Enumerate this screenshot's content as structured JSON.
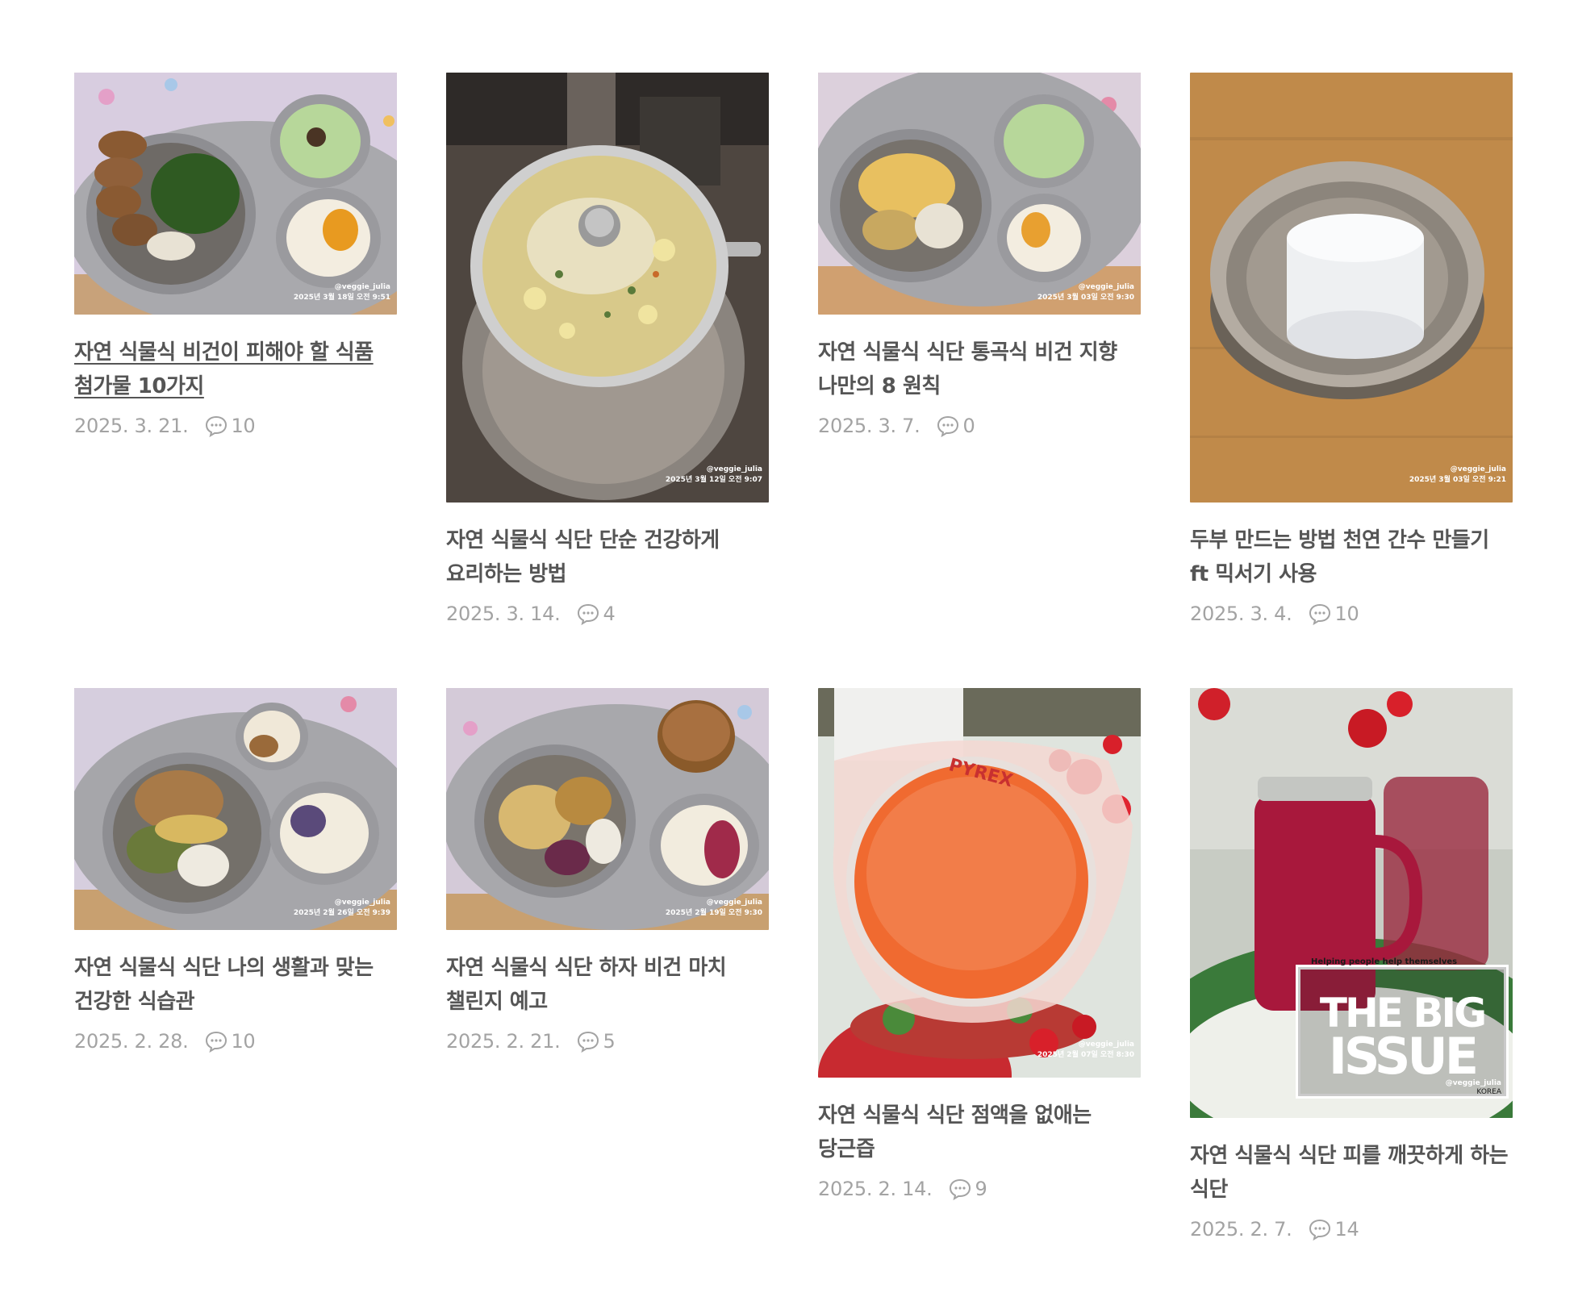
{
  "posts": [
    {
      "title": "자연 식물식 비건이 피해야 할 식품 첨가물 10가지",
      "date": "2025. 3. 21.",
      "comments": "10",
      "watermark": {
        "handle": "@veggie_julia",
        "stamp": "2025년 3월 18일 오전 9:51"
      }
    },
    {
      "title": "자연 식물식 식단 단순 건강하게 요리하는 방법",
      "date": "2025. 3. 14.",
      "comments": "4",
      "watermark": {
        "handle": "@veggie_julia",
        "stamp": "2025년 3월 12일 오전 9:07"
      }
    },
    {
      "title": "자연 식물식 식단 통곡식 비건 지향 나만의 8 원칙",
      "date": "2025. 3. 7.",
      "comments": "0",
      "watermark": {
        "handle": "@veggie_julia",
        "stamp": "2025년 3월 03일 오전 9:30"
      }
    },
    {
      "title": "두부 만드는 방법 천연 간수 만들기 ft 믹서기 사용",
      "date": "2025. 3. 4.",
      "comments": "10",
      "watermark": {
        "handle": "@veggie_julia",
        "stamp": "2025년 3월 03일 오전 9:21"
      }
    },
    {
      "title": "자연 식물식 식단 나의 생활과 맞는 건강한 식습관",
      "date": "2025. 2. 28.",
      "comments": "10",
      "watermark": {
        "handle": "@veggie_julia",
        "stamp": "2025년 2월 26일 오전 9:39"
      }
    },
    {
      "title": "자연 식물식 식단 하자 비건 마치 챌린지 예고",
      "date": "2025. 2. 21.",
      "comments": "5",
      "watermark": {
        "handle": "@veggie_julia",
        "stamp": "2025년 2월 19일 오전 9:30"
      }
    },
    {
      "title": "자연 식물식 식단 점액을 없애는 당근즙",
      "date": "2025. 2. 14.",
      "comments": "9",
      "watermark": {
        "handle": "@veggie_julia",
        "stamp": "2025년 2월 07일 오전 8:30"
      },
      "jar_text": "PYREX"
    },
    {
      "title": "자연 식물식 식단 피를 깨끗하게 하는 식단",
      "date": "2025. 2. 7.",
      "comments": "14",
      "watermark": {
        "handle": "@veggie_julia",
        "stamp": ""
      },
      "logo": {
        "tagline": "Helping people help themselves",
        "line1": "THE BIG",
        "line2": "ISSUE",
        "sub": "KOREA"
      }
    }
  ],
  "colors": {
    "title": "#555555",
    "meta": "#a3a3a3",
    "background": "#ffffff"
  }
}
